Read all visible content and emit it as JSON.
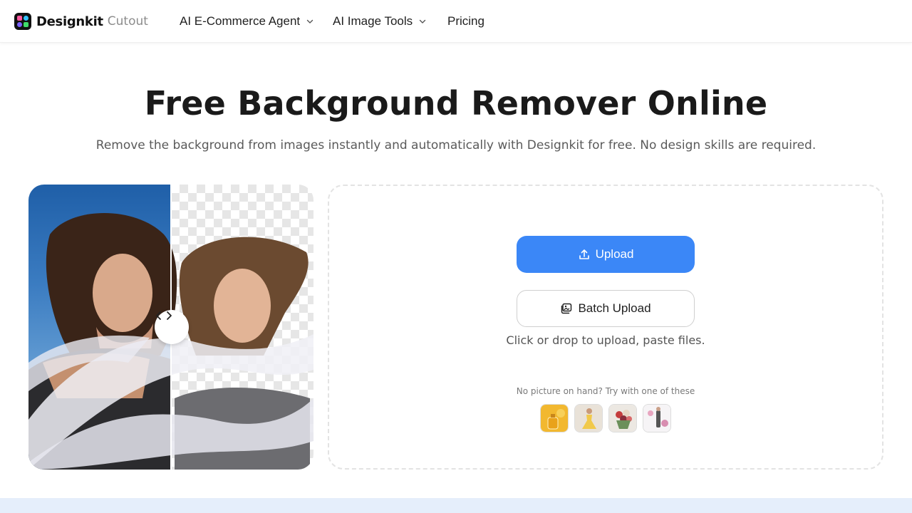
{
  "brand": {
    "name": "Designkit",
    "product": "Cutout"
  },
  "nav": {
    "items": [
      {
        "label": "AI E-Commerce Agent",
        "has_dropdown": true
      },
      {
        "label": "AI Image Tools",
        "has_dropdown": true
      },
      {
        "label": "Pricing",
        "has_dropdown": false
      }
    ]
  },
  "hero": {
    "title": "Free Background Remover Online",
    "subtitle": "Remove the background from images instantly and automatically with Designkit for free. No design skills are required."
  },
  "upload": {
    "primary_label": "Upload",
    "batch_label": "Batch Upload",
    "hint": "Click or drop to upload, paste files.",
    "samples_label": "No picture on hand? Try with one of these",
    "samples": [
      {
        "icon": "perfume-bottle-sample"
      },
      {
        "icon": "dress-model-sample"
      },
      {
        "icon": "flower-bouquet-sample"
      },
      {
        "icon": "fashion-collage-sample"
      }
    ]
  },
  "colors": {
    "accent": "#3b87f7",
    "footer_band": "#e5eefb",
    "dropzone_border": "#e3e3e3"
  }
}
